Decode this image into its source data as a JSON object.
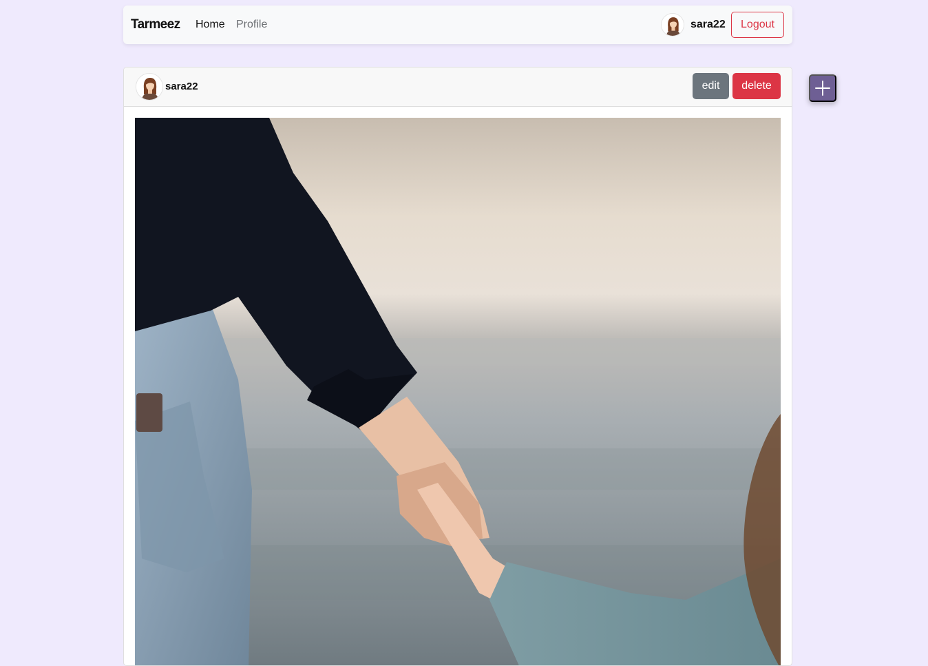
{
  "navbar": {
    "brand": "Tarmeez",
    "links": [
      {
        "label": "Home"
      },
      {
        "label": "Profile"
      }
    ],
    "username": "sara22",
    "logout_label": "Logout"
  },
  "post": {
    "author": "sara22",
    "edit_label": "edit",
    "delete_label": "delete",
    "image_icon": "photo-adult-and-child-holding-hands"
  },
  "fab": {
    "icon": "plus-icon"
  },
  "colors": {
    "background": "#efeafd",
    "danger": "#dc3545",
    "secondary": "#6c757d",
    "fab": "#6e5f94"
  }
}
